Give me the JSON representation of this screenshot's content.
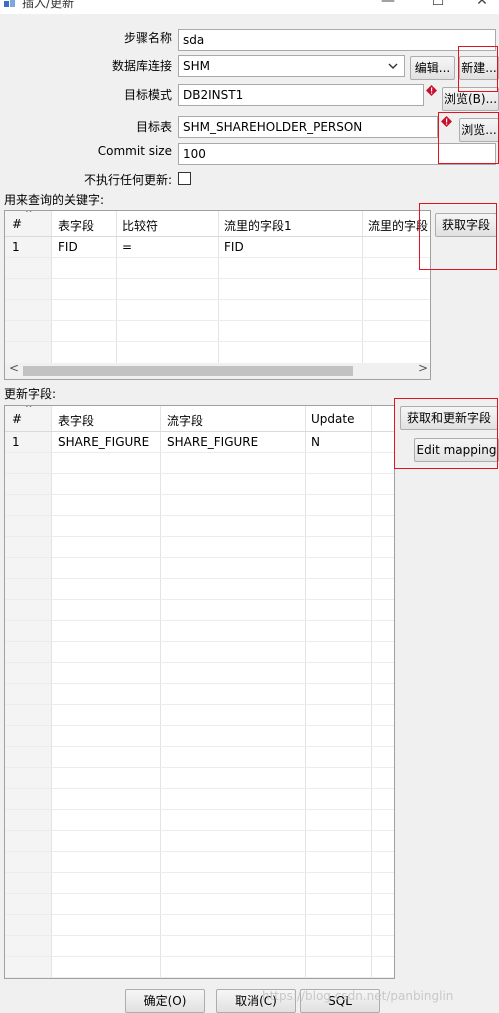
{
  "window": {
    "title": "插入/更新",
    "controls": {
      "minimize": "—",
      "maximize": "☐",
      "close": "✕"
    }
  },
  "form": {
    "step_name": {
      "label": "步骤名称",
      "value": "sda"
    },
    "connection": {
      "label": "数据库连接",
      "value": "SHM",
      "edit_button": "编辑...",
      "new_button": "新建..."
    },
    "target_schema": {
      "label": "目标模式",
      "value": "DB2INST1",
      "browse_button": "浏览(B)..."
    },
    "target_table": {
      "label": "目标表",
      "value": "SHM_SHAREHOLDER_PERSON",
      "browse_button": "浏览..."
    },
    "commit_size": {
      "label": "Commit size",
      "value": "100"
    },
    "no_update": {
      "label": "不执行任何更新:",
      "checked": false
    }
  },
  "key_section": {
    "label": "用来查询的关键字:",
    "headers": [
      "#",
      "表字段",
      "比较符",
      "流里的字段1",
      "流里的字段"
    ],
    "rows": [
      [
        "1",
        "FID",
        "=",
        "FID",
        ""
      ]
    ],
    "get_fields_button": "获取字段"
  },
  "update_section": {
    "label": "更新字段:",
    "headers": [
      "#",
      "表字段",
      "流字段",
      "Update"
    ],
    "rows": [
      [
        "1",
        "SHARE_FIGURE",
        "SHARE_FIGURE",
        "N"
      ]
    ],
    "get_update_fields_button": "获取和更新字段",
    "edit_mapping_button": "Edit mapping"
  },
  "footer": {
    "ok_button": "确定(O)",
    "cancel_button": "取消(C)",
    "sql_button": "SQL"
  },
  "watermark": "https://blog.csdn.net/panbinglin",
  "colors": {
    "highlight_red": "#e0141e",
    "warning_icon": "#c8102e"
  }
}
